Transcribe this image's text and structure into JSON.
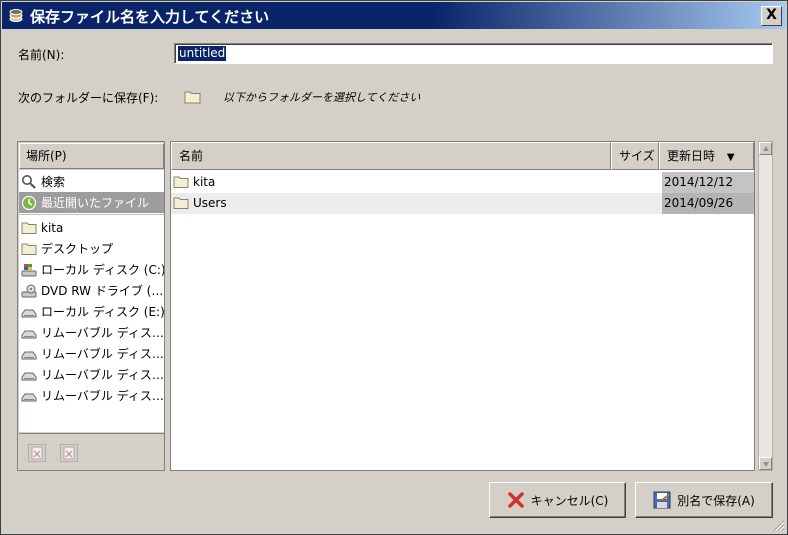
{
  "window": {
    "title": "保存ファイル名を入力してください",
    "close_symbol": "X",
    "title_icon": "stack-icon"
  },
  "name_field": {
    "label": "名前(N):",
    "value": "untitled"
  },
  "folder_row": {
    "label": "次のフォルダーに保存(F):",
    "prompt": "以下からフォルダーを選択してください"
  },
  "places": {
    "header": "場所(P)",
    "items": [
      {
        "label": "検索",
        "icon": "search-icon"
      },
      {
        "label": "最近開いたファイル",
        "icon": "recent-icon",
        "selected": true
      },
      {
        "label": "kita",
        "icon": "folder-icon"
      },
      {
        "label": "デスクトップ",
        "icon": "folder-icon"
      },
      {
        "label": "ローカル ディスク (C:)",
        "icon": "system-drive-icon"
      },
      {
        "label": "DVD RW ドライブ (…",
        "icon": "dvd-drive-icon"
      },
      {
        "label": "ローカル ディスク (E:)",
        "icon": "drive-icon"
      },
      {
        "label": "リムーバブル ディス…",
        "icon": "drive-icon"
      },
      {
        "label": "リムーバブル ディス…",
        "icon": "drive-icon"
      },
      {
        "label": "リムーバブル ディス…",
        "icon": "drive-icon"
      },
      {
        "label": "リムーバブル ディス…",
        "icon": "drive-icon"
      }
    ]
  },
  "files": {
    "columns": {
      "name": "名前",
      "size": "サイズ",
      "modified": "更新日時",
      "sort_indicator": "▼"
    },
    "rows": [
      {
        "name": "kita",
        "icon": "folder-icon",
        "size": "",
        "modified": "2014/12/12"
      },
      {
        "name": "Users",
        "icon": "folder-icon",
        "size": "",
        "modified": "2014/09/26"
      }
    ]
  },
  "buttons": {
    "cancel": "キャンセル(C)",
    "save": "別名で保存(A)"
  },
  "colors": {
    "title_bar": "#0a246a",
    "selection": "#0a246a",
    "cancel_icon": "#d03030"
  }
}
